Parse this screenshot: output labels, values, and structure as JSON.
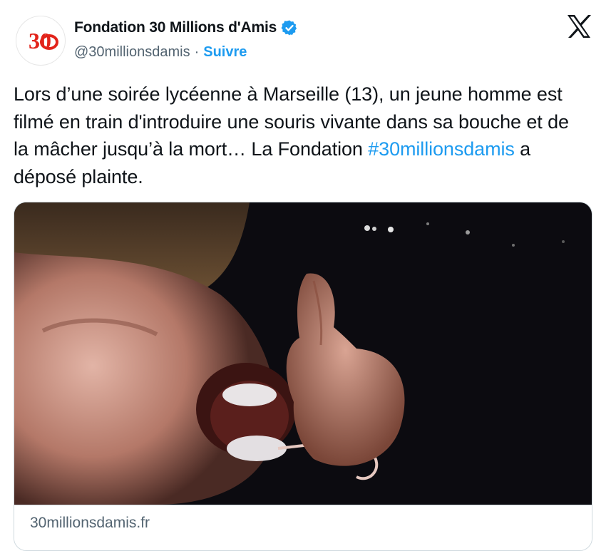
{
  "author": {
    "avatar_icon": "30-millions-damis-logo",
    "avatar_text": "30",
    "name": "Fondation 30 Millions d'Amis",
    "verified_icon": "verified-badge-icon",
    "handle": "@30millionsdamis",
    "separator": "·",
    "follow_label": "Suivre"
  },
  "platform": {
    "logo_icon": "x-logo-icon"
  },
  "tweet": {
    "text_before": "Lors d’une soirée lycéenne à Marseille (13), un jeune homme est filmé en train d'introduire une souris vivante dans sa bouche et de la mâcher jusqu’à la mort… La Fondation ",
    "hashtag": "#30millionsdamis",
    "text_after": " a déposé plainte."
  },
  "card": {
    "image_description_icon": "video-thumbnail",
    "domain": "30millionsdamis.fr"
  },
  "colors": {
    "link": "#1d9bf0",
    "secondary_text": "#536471",
    "brand_red": "#e2231a"
  }
}
